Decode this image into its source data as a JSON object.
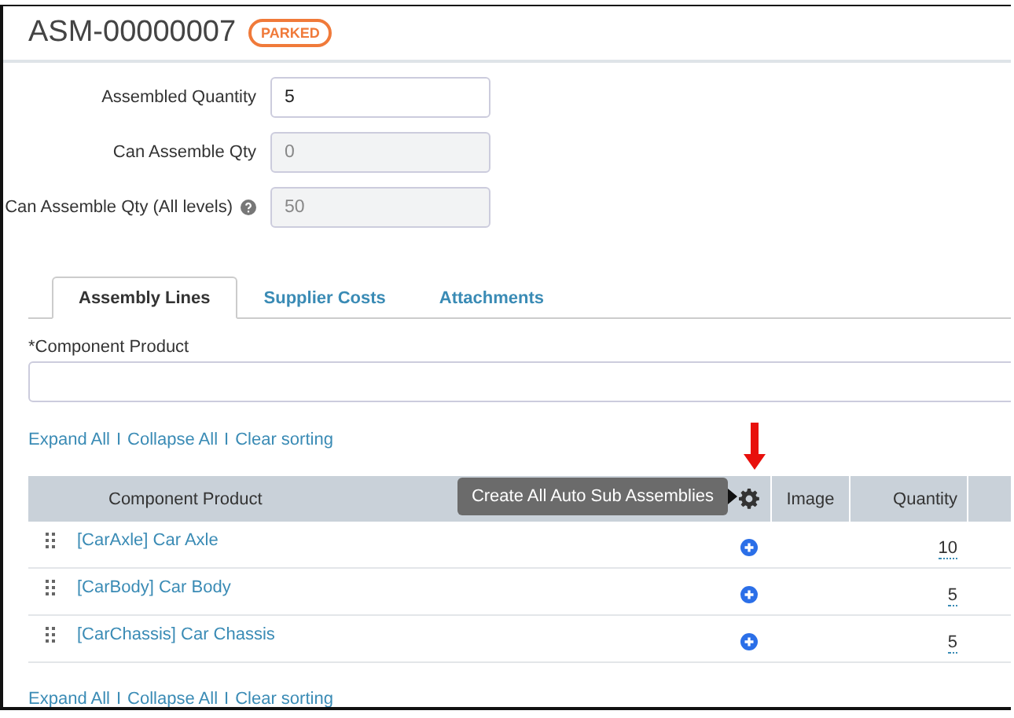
{
  "record": {
    "title": "ASM-00000007",
    "status": "PARKED"
  },
  "fields": [
    {
      "label": "Assembled Quantity",
      "value": "5",
      "disabled": false,
      "help": false
    },
    {
      "label": "Can Assemble Qty",
      "value": "0",
      "disabled": true,
      "help": false
    },
    {
      "label": "Can Assemble Qty (All levels)",
      "value": "50",
      "disabled": true,
      "help": true
    }
  ],
  "tabs": [
    {
      "label": "Assembly Lines",
      "selected": true
    },
    {
      "label": "Supplier Costs",
      "selected": false
    },
    {
      "label": "Attachments",
      "selected": false
    }
  ],
  "component_field": {
    "label": "*Component Product"
  },
  "links_top": {
    "items": [
      "Expand All",
      "Collapse All",
      "Clear sorting"
    ],
    "separators": [
      "I",
      "I"
    ]
  },
  "table": {
    "columns": [
      {
        "kind": "text",
        "label": "Component Product"
      },
      {
        "kind": "gear"
      },
      {
        "kind": "text",
        "label": "Image"
      },
      {
        "kind": "text",
        "label": "Quantity"
      },
      {
        "kind": "blank"
      }
    ],
    "tooltip": "Create All Auto Sub Assemblies",
    "rows": [
      {
        "product": "[CarAxle] Car Axle",
        "quantity": "10"
      },
      {
        "product": "[CarBody] Car Body",
        "quantity": "5"
      },
      {
        "product": "[CarChassis] Car Chassis",
        "quantity": "5"
      }
    ]
  },
  "links_bottom": {
    "items": [
      "Expand All",
      "Collapse All",
      "Clear sorting"
    ],
    "separators": [
      "I",
      "I"
    ]
  }
}
